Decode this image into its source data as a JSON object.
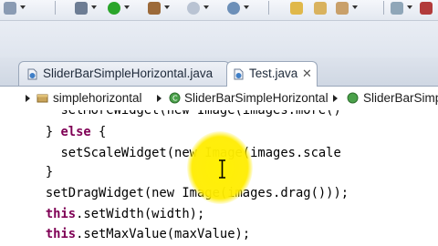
{
  "toolbar": {
    "icons": [
      "save-icon",
      "debug-icon",
      "run-icon",
      "external-tools-icon",
      "web-icon",
      "server-icon",
      "open-type-icon",
      "search-icon",
      "navigate-icon",
      "sync-icon",
      "gem-icon"
    ]
  },
  "editor": {
    "tabs": [
      {
        "label": "SliderBarSimpleHorizontal.java",
        "active": false
      },
      {
        "label": "Test.java",
        "active": true,
        "close": "✕"
      }
    ],
    "breadcrumb": [
      "simplehorizontal",
      "SliderBarSimpleHorizontal",
      "SliderBarSimpl"
    ]
  },
  "code": {
    "line1": "        setMoreWidget(new Image(images.more()",
    "line2_brace": "      } ",
    "line2_kw": "else",
    "line2_rest": " {",
    "line3": "        setScaleWidget(new Image(images.scale",
    "line4": "      }",
    "line5": "      setDragWidget(new Image(images.drag()));",
    "line6_kw": "this",
    "line6_rest": ".setWidth(width);",
    "line7_kw": "this",
    "line7_rest": ".setMaxValue(maxValue);"
  },
  "colors": {
    "keyword": "#7f0055",
    "cursor_highlight": "#ffec00"
  }
}
